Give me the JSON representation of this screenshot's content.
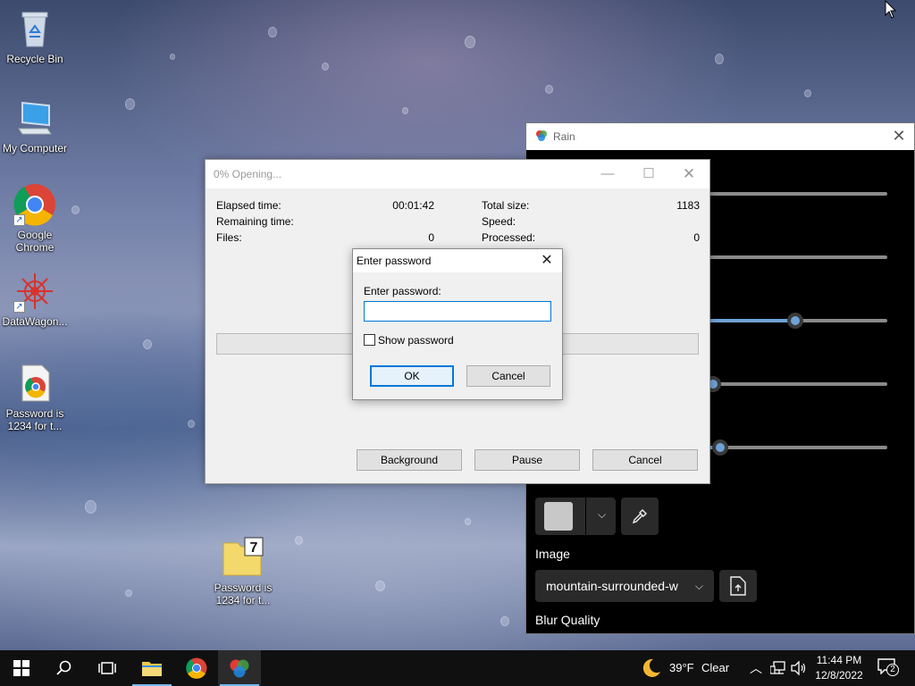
{
  "desktop": {
    "icons": [
      {
        "name": "recycle-bin",
        "label": "Recycle Bin"
      },
      {
        "name": "my-computer",
        "label": "My Computer"
      },
      {
        "name": "google-chrome",
        "label": "Google Chrome"
      },
      {
        "name": "datawagon",
        "label": "DataWagon..."
      },
      {
        "name": "password-file-1",
        "label": "Password is 1234 for t..."
      },
      {
        "name": "password-archive-2",
        "label": "Password is 1234 for t..."
      }
    ]
  },
  "rain_window": {
    "title": "Rain",
    "close_icon": "close-icon",
    "sliders": [
      {
        "name": "slider-1",
        "value": 1.0
      },
      {
        "name": "slider-2",
        "value": 1.0
      },
      {
        "name": "slider-3",
        "value": 0.5
      },
      {
        "name": "slider-4",
        "value": 0.0
      },
      {
        "name": "slider-5",
        "value": 0.05
      }
    ],
    "overlay_color_swatch": "#c8c8c8",
    "image_label": "Image",
    "image_value": "mountain-surrounded-w",
    "blur_label": "Blur Quality"
  },
  "progress_window": {
    "title": "0% Opening...",
    "stats": {
      "elapsed_label": "Elapsed time:",
      "elapsed_value": "00:01:42",
      "remaining_label": "Remaining time:",
      "files_label": "Files:",
      "files_value": "0",
      "total_size_label": "Total size:",
      "total_size_value": "1183",
      "speed_label": "Speed:",
      "processed_label": "Processed:",
      "processed_value": "0"
    },
    "progress_percent": 0,
    "buttons": {
      "background": "Background",
      "pause": "Pause",
      "cancel": "Cancel"
    }
  },
  "password_dialog": {
    "title": "Enter password",
    "label": "Enter password:",
    "value": "",
    "show_password_label": "Show password",
    "show_password_checked": false,
    "ok": "OK",
    "cancel": "Cancel"
  },
  "taskbar": {
    "weather_temp": "39°F",
    "weather_desc": "Clear",
    "time": "11:44 PM",
    "date": "12/8/2022",
    "notification_count": "2"
  }
}
